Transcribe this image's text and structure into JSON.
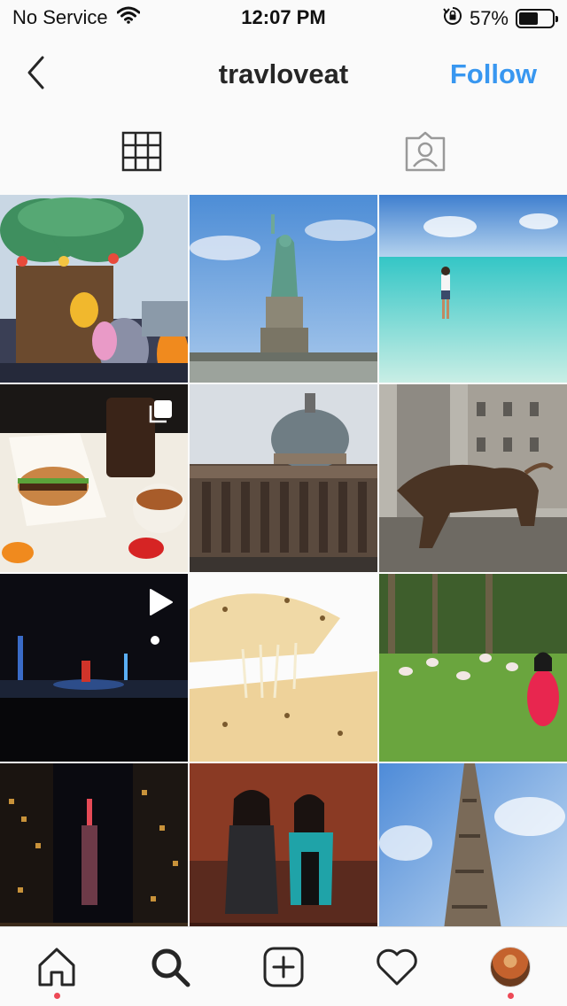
{
  "status_bar": {
    "carrier": "No Service",
    "time": "12:07 PM",
    "battery_percent": "57%",
    "battery_level": 0.57
  },
  "header": {
    "username": "travloveat",
    "follow_label": "Follow",
    "accent_color": "#3897f0"
  },
  "profile_tabs": [
    {
      "icon": "grid-icon",
      "active": true
    },
    {
      "icon": "tagged-person-icon",
      "active": false
    }
  ],
  "posts": [
    {
      "subject": "disneyland-parade-tree",
      "badge": null
    },
    {
      "subject": "statue-of-liberty",
      "badge": null
    },
    {
      "subject": "beach-turquoise-water",
      "badge": null
    },
    {
      "subject": "burger-and-drink",
      "badge": "carousel-icon"
    },
    {
      "subject": "st-peters-basilica",
      "badge": null
    },
    {
      "subject": "charging-bull",
      "badge": null
    },
    {
      "subject": "night-show",
      "badge": "video-play-icon"
    },
    {
      "subject": "cheese-quesadilla",
      "badge": null
    },
    {
      "subject": "flamingos-and-woman",
      "badge": null
    },
    {
      "subject": "empire-state-night",
      "badge": null
    },
    {
      "subject": "wax-figures",
      "badge": null
    },
    {
      "subject": "flatiron-building",
      "badge": null
    }
  ],
  "bottom_nav": [
    {
      "icon": "home-icon",
      "notification_dot": true
    },
    {
      "icon": "search-icon",
      "notification_dot": false
    },
    {
      "icon": "add-post-icon",
      "notification_dot": false
    },
    {
      "icon": "heart-icon",
      "notification_dot": false
    },
    {
      "icon": "profile-avatar",
      "notification_dot": true
    }
  ]
}
